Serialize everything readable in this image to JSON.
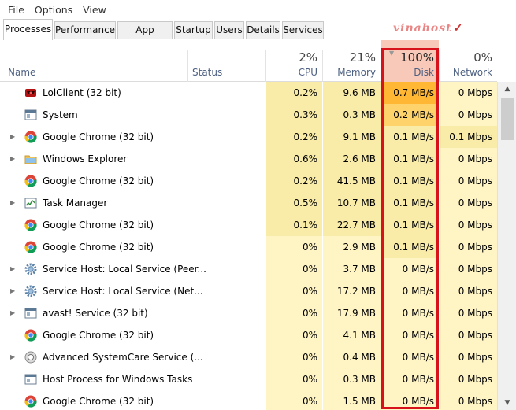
{
  "menu": [
    "File",
    "Options",
    "View"
  ],
  "tabs": [
    "Processes",
    "Performance",
    "App history",
    "Startup",
    "Users",
    "Details",
    "Services"
  ],
  "watermark": "vinahost",
  "columns": {
    "name": "Name",
    "status": "Status",
    "cpu": {
      "pct": "2%",
      "label": "CPU"
    },
    "memory": {
      "pct": "21%",
      "label": "Memory"
    },
    "disk": {
      "pct": "100%",
      "label": "Disk"
    },
    "network": {
      "pct": "0%",
      "label": "Network"
    }
  },
  "colors": {
    "heat_low": "#fff4c4",
    "heat_mid": "#f9eca8",
    "heat_high": "#ffd36b",
    "heat_very_high": "#ffb734",
    "disk_header_bg": "#f8c8b8",
    "highlight_border": "#d8121b"
  },
  "processes": [
    {
      "name": "LolClient (32 bit)",
      "icon": "lolclient-icon",
      "expandable": false,
      "status": "",
      "cpu": "0.2%",
      "memory": "9.6 MB",
      "disk": "0.7 MB/s",
      "network": "0 Mbps",
      "heat": {
        "cpu": "mid",
        "memory": "mid",
        "disk": "very_high",
        "network": "low"
      }
    },
    {
      "name": "System",
      "icon": "system-window-icon",
      "expandable": false,
      "status": "",
      "cpu": "0.3%",
      "memory": "0.3 MB",
      "disk": "0.2 MB/s",
      "network": "0 Mbps",
      "heat": {
        "cpu": "mid",
        "memory": "mid",
        "disk": "high",
        "network": "low"
      }
    },
    {
      "name": "Google Chrome (32 bit)",
      "icon": "chrome-icon",
      "expandable": true,
      "status": "",
      "cpu": "0.2%",
      "memory": "9.1 MB",
      "disk": "0.1 MB/s",
      "network": "0.1 Mbps",
      "heat": {
        "cpu": "mid",
        "memory": "mid",
        "disk": "mid",
        "network": "mid"
      }
    },
    {
      "name": "Windows Explorer",
      "icon": "folder-icon",
      "expandable": true,
      "status": "",
      "cpu": "0.6%",
      "memory": "2.6 MB",
      "disk": "0.1 MB/s",
      "network": "0 Mbps",
      "heat": {
        "cpu": "mid",
        "memory": "mid",
        "disk": "mid",
        "network": "low"
      }
    },
    {
      "name": "Google Chrome (32 bit)",
      "icon": "chrome-icon",
      "expandable": false,
      "status": "",
      "cpu": "0.2%",
      "memory": "41.5 MB",
      "disk": "0.1 MB/s",
      "network": "0 Mbps",
      "heat": {
        "cpu": "mid",
        "memory": "mid",
        "disk": "mid",
        "network": "low"
      }
    },
    {
      "name": "Task Manager",
      "icon": "task-manager-icon",
      "expandable": true,
      "status": "",
      "cpu": "0.5%",
      "memory": "10.7 MB",
      "disk": "0.1 MB/s",
      "network": "0 Mbps",
      "heat": {
        "cpu": "mid",
        "memory": "mid",
        "disk": "mid",
        "network": "low"
      }
    },
    {
      "name": "Google Chrome (32 bit)",
      "icon": "chrome-icon",
      "expandable": false,
      "status": "",
      "cpu": "0.1%",
      "memory": "22.7 MB",
      "disk": "0.1 MB/s",
      "network": "0 Mbps",
      "heat": {
        "cpu": "mid",
        "memory": "mid",
        "disk": "mid",
        "network": "low"
      }
    },
    {
      "name": "Google Chrome (32 bit)",
      "icon": "chrome-icon",
      "expandable": false,
      "status": "",
      "cpu": "0%",
      "memory": "2.9 MB",
      "disk": "0.1 MB/s",
      "network": "0 Mbps",
      "heat": {
        "cpu": "low",
        "memory": "low",
        "disk": "mid",
        "network": "low"
      }
    },
    {
      "name": "Service Host: Local Service (Peer...",
      "icon": "gear-icon",
      "expandable": true,
      "status": "",
      "cpu": "0%",
      "memory": "3.7 MB",
      "disk": "0 MB/s",
      "network": "0 Mbps",
      "heat": {
        "cpu": "low",
        "memory": "low",
        "disk": "low",
        "network": "low"
      }
    },
    {
      "name": "Service Host: Local Service (Net...",
      "icon": "gear-icon",
      "expandable": true,
      "status": "",
      "cpu": "0%",
      "memory": "17.2 MB",
      "disk": "0 MB/s",
      "network": "0 Mbps",
      "heat": {
        "cpu": "low",
        "memory": "low",
        "disk": "low",
        "network": "low"
      }
    },
    {
      "name": "avast! Service (32 bit)",
      "icon": "system-window-icon",
      "expandable": true,
      "status": "",
      "cpu": "0%",
      "memory": "17.9 MB",
      "disk": "0 MB/s",
      "network": "0 Mbps",
      "heat": {
        "cpu": "low",
        "memory": "low",
        "disk": "low",
        "network": "low"
      }
    },
    {
      "name": "Google Chrome (32 bit)",
      "icon": "chrome-icon",
      "expandable": false,
      "status": "",
      "cpu": "0%",
      "memory": "4.1 MB",
      "disk": "0 MB/s",
      "network": "0 Mbps",
      "heat": {
        "cpu": "low",
        "memory": "low",
        "disk": "low",
        "network": "low"
      }
    },
    {
      "name": "Advanced SystemCare Service (...",
      "icon": "advanced-systemcare-icon",
      "expandable": true,
      "status": "",
      "cpu": "0%",
      "memory": "0.4 MB",
      "disk": "0 MB/s",
      "network": "0 Mbps",
      "heat": {
        "cpu": "low",
        "memory": "low",
        "disk": "low",
        "network": "low"
      }
    },
    {
      "name": "Host Process for Windows Tasks",
      "icon": "system-window-icon",
      "expandable": false,
      "status": "",
      "cpu": "0%",
      "memory": "0.3 MB",
      "disk": "0 MB/s",
      "network": "0 Mbps",
      "heat": {
        "cpu": "low",
        "memory": "low",
        "disk": "low",
        "network": "low"
      }
    },
    {
      "name": "Google Chrome (32 bit)",
      "icon": "chrome-icon",
      "expandable": false,
      "status": "",
      "cpu": "0%",
      "memory": "1.5 MB",
      "disk": "0 MB/s",
      "network": "0 Mbps",
      "heat": {
        "cpu": "low",
        "memory": "low",
        "disk": "low",
        "network": "low"
      }
    }
  ]
}
